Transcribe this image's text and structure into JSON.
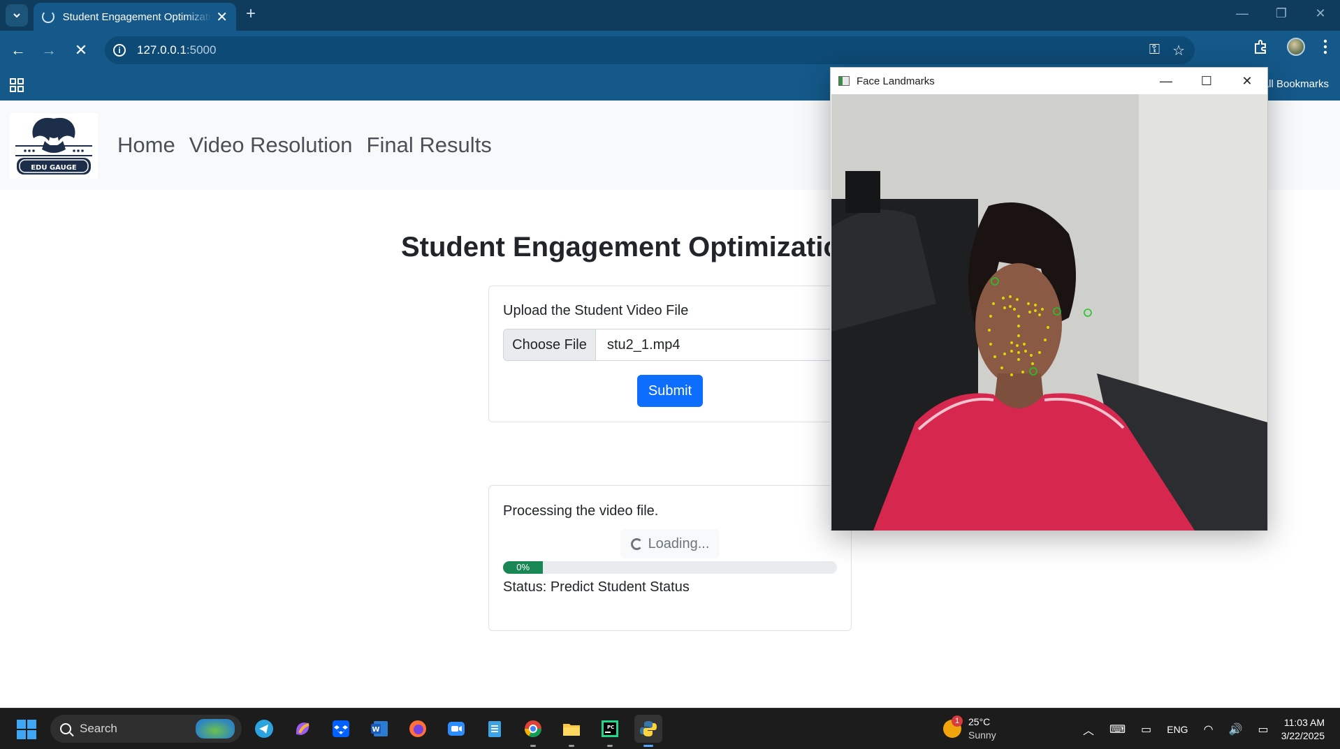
{
  "browser": {
    "tab_title": "Student Engagement Optimization",
    "url_host": "127.0.0.1",
    "url_port": ":5000",
    "bookmarks_label": "All Bookmarks"
  },
  "navbar": {
    "logo_text": "EDU GAUGE",
    "links": [
      "Home",
      "Video Resolution",
      "Final Results"
    ]
  },
  "main": {
    "title": "Student Engagement Optimization",
    "upload": {
      "label": "Upload the Student Video File",
      "choose_button": "Choose File",
      "file_name": "stu2_1.mp4",
      "submit_label": "Submit"
    },
    "processing": {
      "message": "Processing the video file.",
      "loading_label": "Loading...",
      "progress_percent": 0,
      "progress_label": "0%",
      "status": "Status: Predict Student Status"
    }
  },
  "cv_window": {
    "title": "Face Landmarks"
  },
  "taskbar": {
    "search_label": "Search",
    "weather_badge": "1",
    "temperature": "25°C",
    "condition": "Sunny",
    "language": "ENG",
    "time": "11:03 AM",
    "date": "3/22/2025"
  },
  "colors": {
    "primary": "#0d6efd",
    "success": "#198754",
    "chrome_tab_bar": "#0f3b5c",
    "chrome_toolbar": "#14598a"
  }
}
